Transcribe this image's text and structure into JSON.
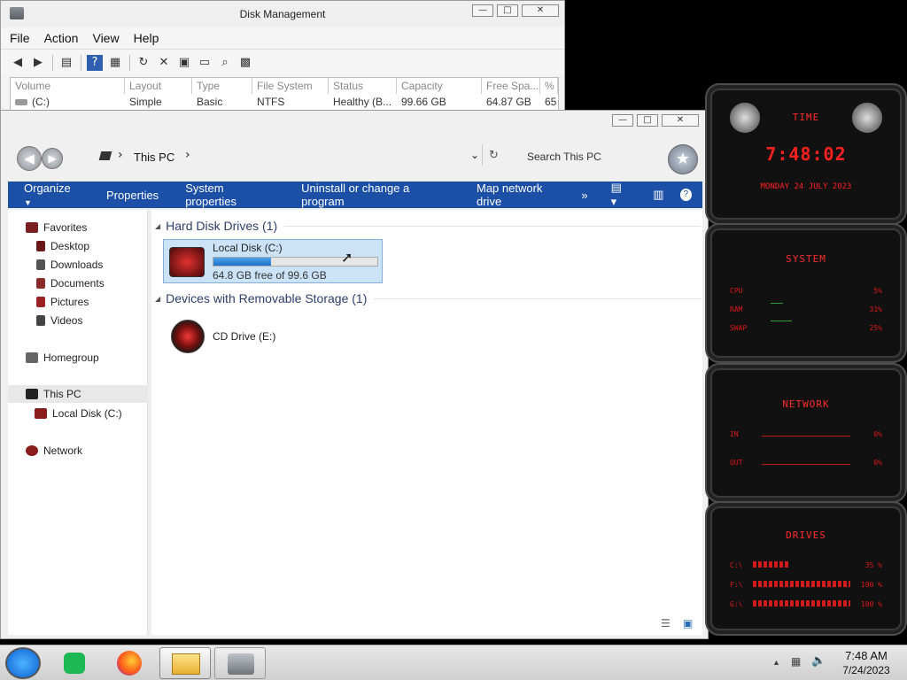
{
  "disk_management": {
    "title": "Disk Management",
    "menu": [
      "File",
      "Action",
      "View",
      "Help"
    ],
    "columns": [
      "Volume",
      "Layout",
      "Type",
      "File System",
      "Status",
      "Capacity",
      "Free Spa...",
      "%"
    ],
    "row": {
      "volume": "(C:)",
      "layout": "Simple",
      "type": "Basic",
      "file_system": "NTFS",
      "status": "Healthy (B...",
      "capacity": "99.66 GB",
      "free_space": "64.87 GB",
      "percent": "65"
    }
  },
  "explorer": {
    "breadcrumb": "This PC",
    "search_placeholder": "Search This PC",
    "commands": [
      "Organize",
      "Properties",
      "System properties",
      "Uninstall or change a program",
      "Map network drive"
    ],
    "nav": {
      "favorites": "Favorites",
      "desktop": "Desktop",
      "downloads": "Downloads",
      "documents": "Documents",
      "pictures": "Pictures",
      "videos": "Videos",
      "homegroup": "Homegroup",
      "this_pc": "This PC",
      "local_disk": "Local Disk (C:)",
      "network": "Network"
    },
    "groups": {
      "hard_disk": "Hard Disk Drives (1)",
      "removable": "Devices with Removable Storage (1)"
    },
    "local_disk": {
      "name": "Local Disk (C:)",
      "free_text": "64.8 GB free of 99.6 GB",
      "used_fraction": 0.35
    },
    "cd_drive": "CD Drive (E:)"
  },
  "gadgets": {
    "time": {
      "title": "TIME",
      "clock": "7:48:02",
      "date": "MONDAY 24 JULY 2023"
    },
    "system": {
      "title": "SYSTEM",
      "rows": [
        {
          "label": "CPU",
          "value": "5%"
        },
        {
          "label": "RAM",
          "value": "31%"
        },
        {
          "label": "SWAP",
          "value": "25%"
        }
      ]
    },
    "network": {
      "title": "NETWORK",
      "rows": [
        {
          "label": "IN",
          "value": "0%"
        },
        {
          "label": "OUT",
          "value": "0%"
        }
      ]
    },
    "drives": {
      "title": "DRIVES",
      "rows": [
        {
          "label": "C:\\",
          "value": "35 %"
        },
        {
          "label": "F:\\",
          "value": "100 %"
        },
        {
          "label": "G:\\",
          "value": "100 %"
        }
      ]
    }
  },
  "taskbar": {
    "time": "7:48 AM",
    "date": "7/24/2023"
  }
}
